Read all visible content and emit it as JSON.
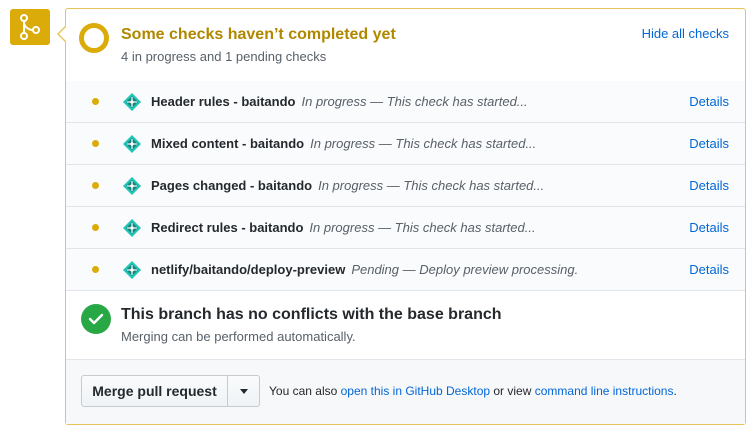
{
  "status": {
    "title": "Some checks haven’t completed yet",
    "subtitle": "4 in progress and 1 pending checks",
    "hide_link": "Hide all checks"
  },
  "checks": [
    {
      "name": "Header rules - baitando",
      "description": "In progress — This check has started...",
      "details": "Details"
    },
    {
      "name": "Mixed content - baitando",
      "description": "In progress — This check has started...",
      "details": "Details"
    },
    {
      "name": "Pages changed - baitando",
      "description": "In progress — This check has started...",
      "details": "Details"
    },
    {
      "name": "Redirect rules - baitando",
      "description": "In progress — This check has started...",
      "details": "Details"
    },
    {
      "name": "netlify/baitando/deploy-preview",
      "description": "Pending — Deploy preview processing.",
      "details": "Details"
    }
  ],
  "conflict": {
    "title": "This branch has no conflicts with the base branch",
    "subtitle": "Merging can be performed automatically."
  },
  "merge": {
    "button_label": "Merge pull request",
    "note_prefix": "You can also ",
    "desktop_link": "open this in GitHub Desktop",
    "note_middle": " or view ",
    "cli_link": "command line instructions",
    "note_suffix": "."
  },
  "colors": {
    "pending": "#dbab09",
    "success": "#28a745",
    "link": "#0366d6",
    "netlify": "#20c6b7"
  },
  "icons": {
    "merge": "git-merge-icon",
    "status": "pending-ring-icon",
    "check_dot": "pending-dot-icon",
    "check_app": "netlify-icon",
    "success": "check-circle-icon",
    "dropdown": "caret-down-icon"
  }
}
